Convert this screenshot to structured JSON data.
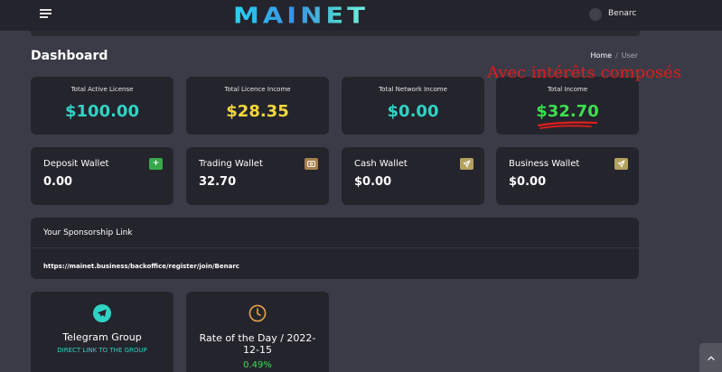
{
  "header": {
    "logo": "MAINET",
    "username": "Benarc"
  },
  "page": {
    "title": "Dashboard"
  },
  "breadcrumb": {
    "home": "Home",
    "separator": "/",
    "current": "User"
  },
  "annotation": {
    "text": "Avec intérêts composés",
    "color": "#e01c1c"
  },
  "stats": [
    {
      "label": "Total Active License",
      "value": "$100.00",
      "color": "#2fd3c5"
    },
    {
      "label": "Total Licence Income",
      "value": "$28.35",
      "color": "#f3d83c"
    },
    {
      "label": "Total Network Income",
      "value": "$0.00",
      "color": "#2fd3c5"
    },
    {
      "label": "Total Income",
      "value": "$32.70",
      "color": "#3be04e"
    }
  ],
  "wallets": [
    {
      "label": "Deposit Wallet",
      "value": "0.00",
      "button_icon": "plus-icon"
    },
    {
      "label": "Trading Wallet",
      "value": "32.70",
      "button_icon": "money-icon"
    },
    {
      "label": "Cash Wallet",
      "value": "$0.00",
      "button_icon": "send-icon"
    },
    {
      "label": "Business Wallet",
      "value": "$0.00",
      "button_icon": "send-icon"
    }
  ],
  "sponsorship": {
    "title": "Your Sponsorship Link",
    "link": "https://mainet.business/backoffice/register/join/Benarc"
  },
  "telegram": {
    "title": "Telegram Group",
    "subtitle": "DIRECT LINK TO THE GROUP",
    "icon": "telegram-icon"
  },
  "rate": {
    "title_line1": "Rate of the Day / 2022-",
    "title_line2": "12-15",
    "value": "0.49%",
    "icon": "clock-icon"
  },
  "colors": {
    "accent": "#2fd3c5",
    "card_bg": "#24242c",
    "page_bg": "#3a3b47"
  }
}
